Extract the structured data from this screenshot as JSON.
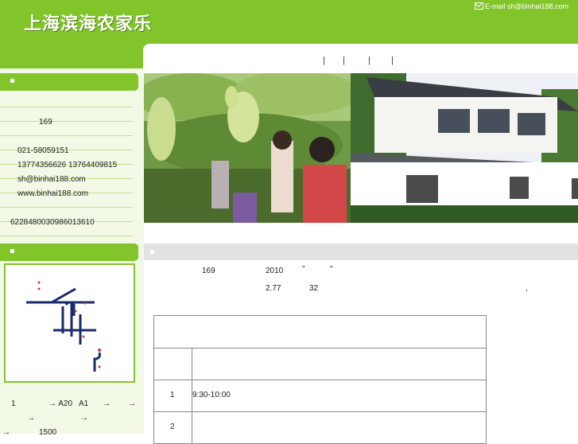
{
  "header": {
    "logo_text": "上海滨海农家乐",
    "email_label": "E-mail sh@binhai188.com"
  },
  "nav": {
    "separators": [
      "|",
      "|",
      "|",
      "|"
    ]
  },
  "left": {
    "contact_lines": [
      "169",
      "021-58059151",
      "13774356626 13764409815",
      "sh@binhai188.com",
      "www.binhai188.com",
      "6228480030986013610"
    ],
    "route_lines": [
      "1",
      "→ A20",
      "A1",
      "→",
      "→",
      "→",
      "→",
      "→",
      "1500"
    ]
  },
  "main": {
    "intro_row1": [
      "169",
      "2010",
      "\"",
      "\""
    ],
    "intro_row2": [
      "2.77",
      "32",
      ","
    ]
  },
  "schedule": {
    "rows": [
      {
        "num": "1",
        "time": "9:30-10:00"
      },
      {
        "num": "2",
        "time": ""
      }
    ]
  },
  "colors": {
    "brand_green": "#82c52a",
    "light_green": "#f2f9e6",
    "section_gray": "#e2e2e2"
  },
  "icons": [
    "email-icon",
    "bullet-icon",
    "map-icon"
  ]
}
